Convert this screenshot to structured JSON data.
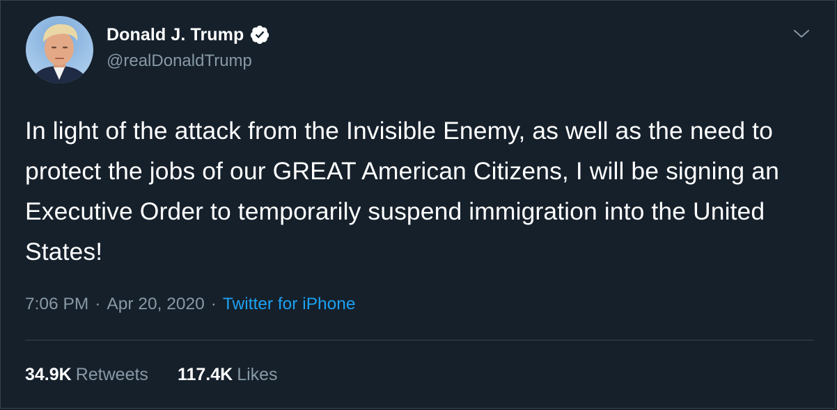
{
  "author": {
    "name": "Donald J. Trump",
    "handle": "@realDonaldTrump",
    "verified": true
  },
  "tweet": {
    "text": "In light of the attack from the Invisible Enemy, as well as the need to protect the jobs of our GREAT American Citizens, I will be signing an Executive Order to temporarily suspend immigration into the United States!",
    "time": "7:06 PM",
    "separator": "·",
    "date": "Apr 20, 2020",
    "source": "Twitter for iPhone"
  },
  "stats": {
    "retweets_count": "34.9K",
    "retweets_label": "Retweets",
    "likes_count": "117.4K",
    "likes_label": "Likes"
  },
  "colors": {
    "background": "#15202b",
    "text_primary": "#ffffff",
    "text_secondary": "#8899a6",
    "link": "#1da1f2",
    "divider": "#38444d"
  },
  "icons": {
    "verified": "verified-badge-icon",
    "menu": "chevron-down-icon"
  }
}
